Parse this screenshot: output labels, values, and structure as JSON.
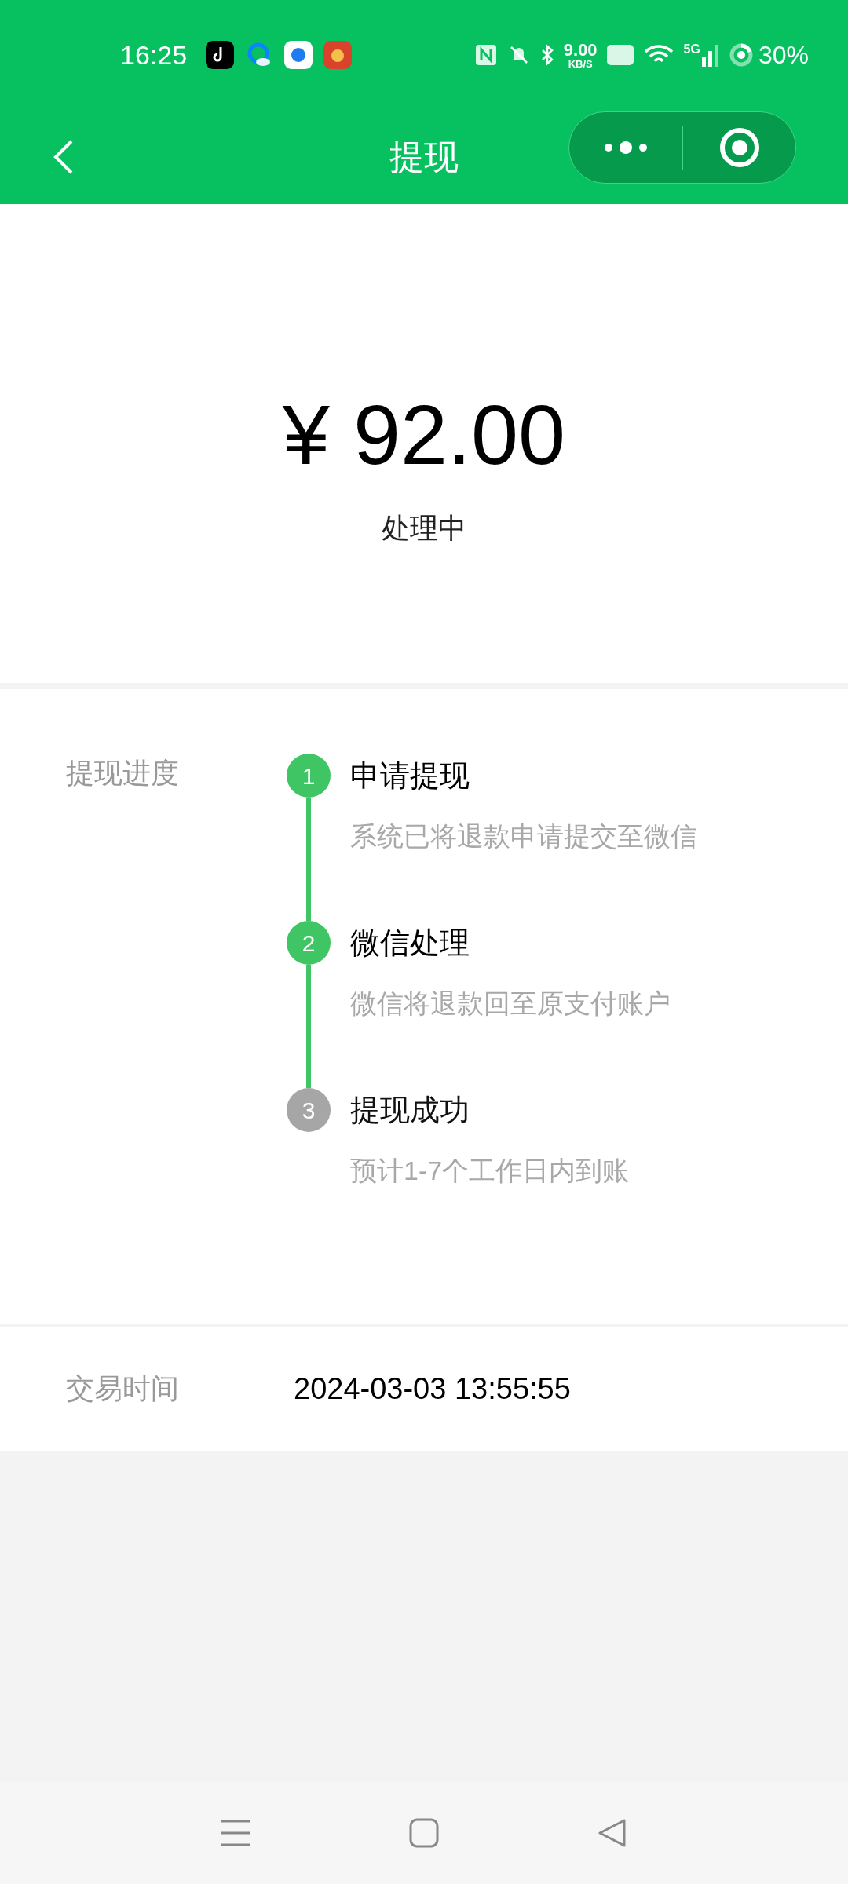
{
  "status_bar": {
    "time": "16:25",
    "speed_value": "9.00",
    "speed_unit": "KB/S",
    "network": "5G",
    "battery": "30%"
  },
  "header": {
    "title": "提现"
  },
  "amount": {
    "value": "¥ 92.00",
    "status": "处理中"
  },
  "progress": {
    "label": "提现进度",
    "steps": [
      {
        "number": "1",
        "title": "申请提现",
        "description": "系统已将退款申请提交至微信",
        "completed": true
      },
      {
        "number": "2",
        "title": "微信处理",
        "description": "微信将退款回至原支付账户",
        "completed": true
      },
      {
        "number": "3",
        "title": "提现成功",
        "description": "预计1-7个工作日内到账",
        "completed": false
      }
    ]
  },
  "transaction": {
    "label": "交易时间",
    "value": "2024-03-03 13:55:55"
  }
}
